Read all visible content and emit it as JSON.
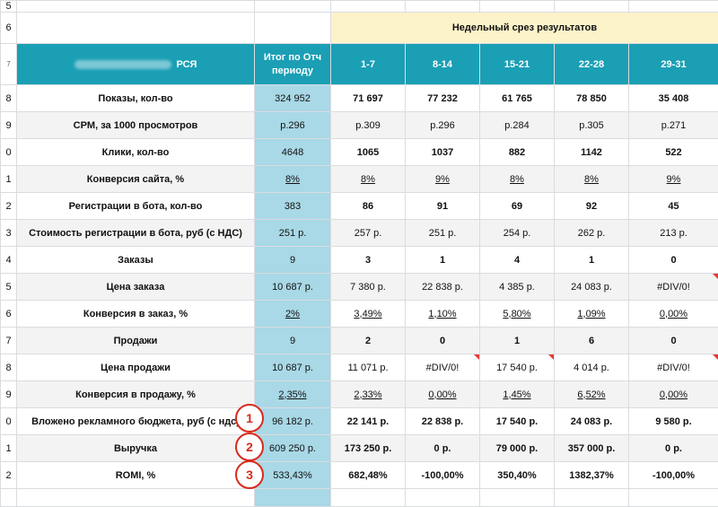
{
  "sheet": {
    "name": "РСЯ",
    "section_title": "Недельный срез результатов",
    "total_header": [
      "Итог по Отч",
      "периоду"
    ],
    "weeks": [
      "1-7",
      "8-14",
      "15-21",
      "22-28",
      "29-31"
    ],
    "row_numbers": [
      "5",
      "6",
      "7",
      "8",
      "9",
      "0",
      "1",
      "2",
      "3",
      "4",
      "5",
      "6",
      "7",
      "8",
      "9",
      "0",
      "1",
      "2",
      ""
    ],
    "rows": [
      {
        "label": "Показы, кол-во",
        "total": "324 952",
        "weeks": [
          "71 697",
          "77 232",
          "61 765",
          "78 850",
          "35 408"
        ]
      },
      {
        "label": "CPM, за 1000 просмотров",
        "total": "р.296",
        "weeks": [
          "р.309",
          "р.296",
          "р.284",
          "р.305",
          "р.271"
        ]
      },
      {
        "label": "Клики, кол-во",
        "total": "4648",
        "weeks": [
          "1065",
          "1037",
          "882",
          "1142",
          "522"
        ]
      },
      {
        "label": "Конверсия сайта, %",
        "total": "8%",
        "weeks": [
          "8%",
          "9%",
          "8%",
          "8%",
          "9%"
        ]
      },
      {
        "label": "Регистрации в бота, кол-во",
        "total": "383",
        "weeks": [
          "86",
          "91",
          "69",
          "92",
          "45"
        ]
      },
      {
        "label": "Стоимость регистрации в бота, руб (с НДС)",
        "total": "251 р.",
        "weeks": [
          "257 р.",
          "251 р.",
          "254 р.",
          "262 р.",
          "213 р."
        ]
      },
      {
        "label": "Заказы",
        "total": "9",
        "weeks": [
          "3",
          "1",
          "4",
          "1",
          "0"
        ]
      },
      {
        "label": "Цена заказа",
        "total": "10 687 р.",
        "weeks": [
          "7 380 р.",
          "22 838 р.",
          "4 385 р.",
          "24 083 р.",
          "#DIV/0!"
        ]
      },
      {
        "label": "Конверсия в заказ, %",
        "total": "2%",
        "weeks": [
          "3,49%",
          "1,10%",
          "5,80%",
          "1,09%",
          "0,00%"
        ]
      },
      {
        "label": "Продажи",
        "total": "9",
        "weeks": [
          "2",
          "0",
          "1",
          "6",
          "0"
        ]
      },
      {
        "label": "Цена продажи",
        "total": "10 687 р.",
        "weeks": [
          "11 071 р.",
          "#DIV/0!",
          "17 540 р.",
          "4 014 р.",
          "#DIV/0!"
        ]
      },
      {
        "label": "Конверсия в продажу, %",
        "total": "2,35%",
        "weeks": [
          "2,33%",
          "0,00%",
          "1,45%",
          "6,52%",
          "0,00%"
        ]
      },
      {
        "label": "Вложено рекламного бюджета, руб (с ндс)",
        "total": "96 182 р.",
        "weeks": [
          "22 141 р.",
          "22 838 р.",
          "17 540 р.",
          "24 083 р.",
          "9 580 р."
        ]
      },
      {
        "label": "Выручка",
        "total": "609 250 р.",
        "weeks": [
          "173 250 р.",
          "0 р.",
          "79 000 р.",
          "357 000 р.",
          "0 р."
        ]
      },
      {
        "label": "ROMI, %",
        "total": "533,43%",
        "weeks": [
          "682,48%",
          "-100,00%",
          "350,40%",
          "1382,37%",
          "-100,00%"
        ]
      }
    ],
    "markers": [
      "1",
      "2",
      "3"
    ]
  },
  "colors": {
    "header_teal": "#1b9fb4",
    "total_column": "#a9d8e6",
    "section_yellow": "#fdf3c9",
    "marker_red": "#d92a1c"
  }
}
